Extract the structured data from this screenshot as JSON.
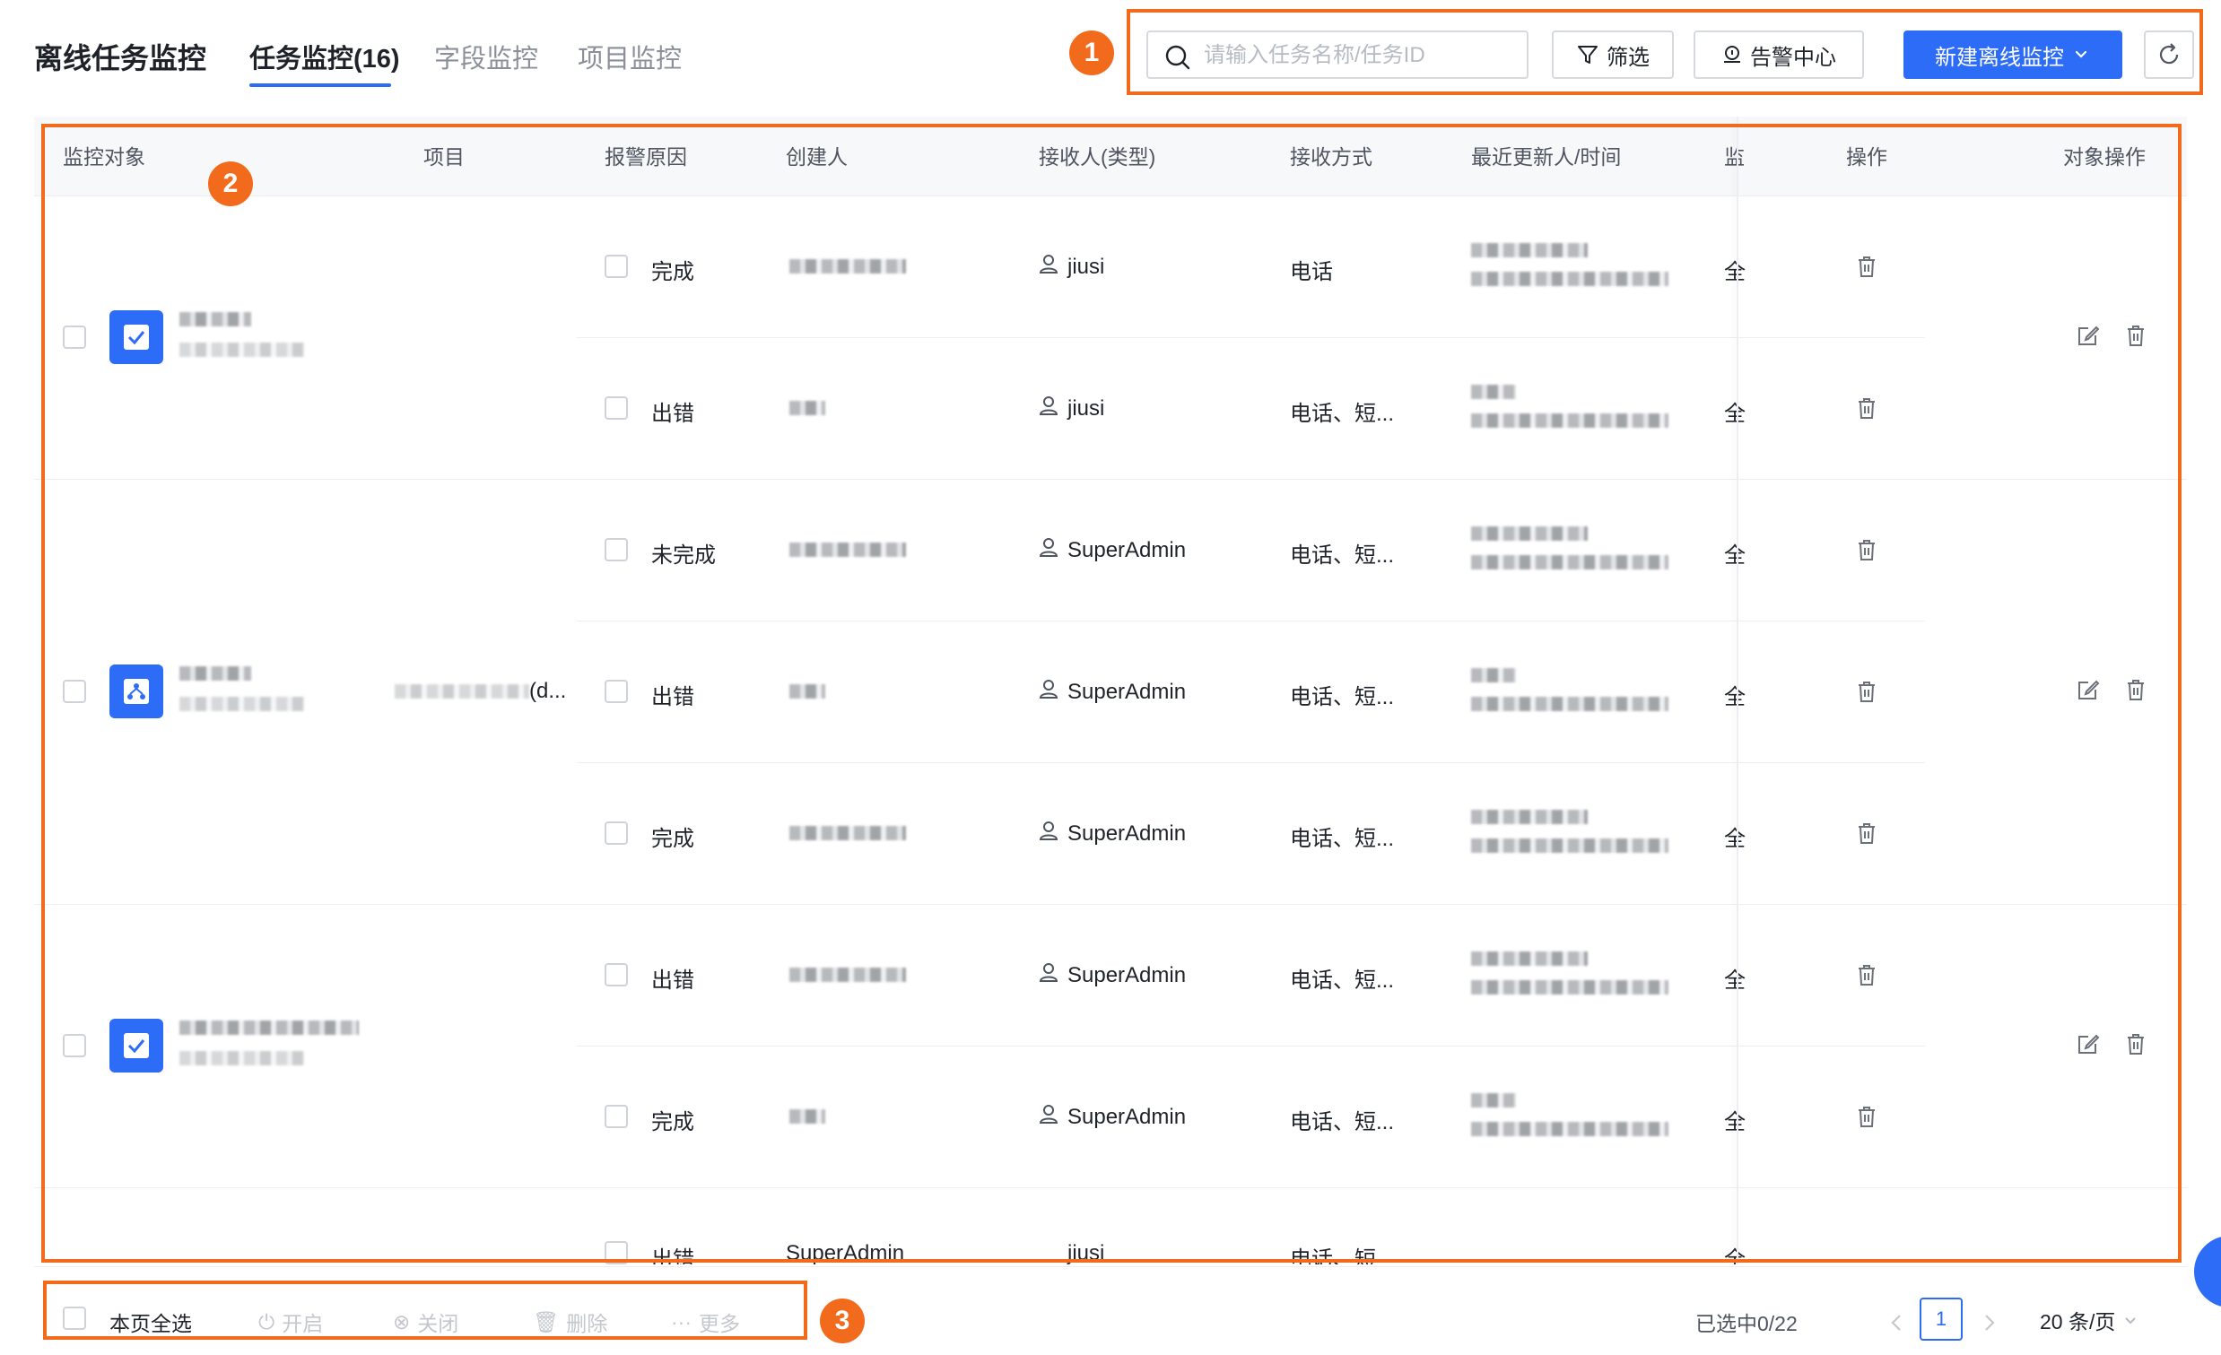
{
  "header": {
    "title": "离线任务监控",
    "tabs": [
      {
        "label": "任务监控(16)",
        "active": true
      },
      {
        "label": "字段监控",
        "active": false
      },
      {
        "label": "项目监控",
        "active": false
      }
    ]
  },
  "toolbar": {
    "search_placeholder": "请输入任务名称/任务ID",
    "filter_label": "筛选",
    "alert_center_label": "告警中心",
    "new_monitor_label": "新建离线监控"
  },
  "annotations": {
    "badge1": "1",
    "badge2": "2",
    "badge3": "3"
  },
  "table": {
    "columns": {
      "object": "监控对象",
      "project": "项目",
      "reason": "报警原因",
      "creator": "创建人",
      "receiver": "接收人(类型)",
      "method": "接收方式",
      "updated": "最近更新人/时间",
      "status_partial": "监",
      "ops": "操作",
      "obj_ops": "对象操作"
    },
    "groups": [
      {
        "icon": "check-task-icon",
        "project": "",
        "rows": [
          {
            "reason": "完成",
            "receiver": "jiusi",
            "method": "电话",
            "status": "全"
          },
          {
            "reason": "出错",
            "receiver": "jiusi",
            "method": "电话、短...",
            "status": "全"
          }
        ]
      },
      {
        "icon": "workflow-icon",
        "project": "(d...",
        "rows": [
          {
            "reason": "未完成",
            "receiver": "SuperAdmin",
            "method": "电话、短...",
            "status": "全"
          },
          {
            "reason": "出错",
            "receiver": "SuperAdmin",
            "method": "电话、短...",
            "status": "全"
          },
          {
            "reason": "完成",
            "receiver": "SuperAdmin",
            "method": "电话、短...",
            "status": "全"
          }
        ]
      },
      {
        "icon": "check-task-icon",
        "project": "",
        "rows": [
          {
            "reason": "出错",
            "receiver": "SuperAdmin",
            "method": "电话、短...",
            "status": "全"
          },
          {
            "reason": "完成",
            "receiver": "SuperAdmin",
            "method": "电话、短...",
            "status": "全"
          }
        ]
      }
    ],
    "partial_row": {
      "reason": "出错",
      "creator": "SuperAdmin",
      "receiver": "jiusi",
      "method": "电话、短",
      "status": "全"
    }
  },
  "footer": {
    "select_all_label": "本页全选",
    "enable_label": "开启",
    "disable_label": "关闭",
    "delete_label": "删除",
    "more_label": "更多",
    "selected_info": "已选中0/22",
    "current_page": "1",
    "page_size_label": "20 条/页"
  },
  "colors": {
    "primary": "#2d6cf6",
    "annotation": "#f26b1d",
    "border": "#d6d9de"
  }
}
